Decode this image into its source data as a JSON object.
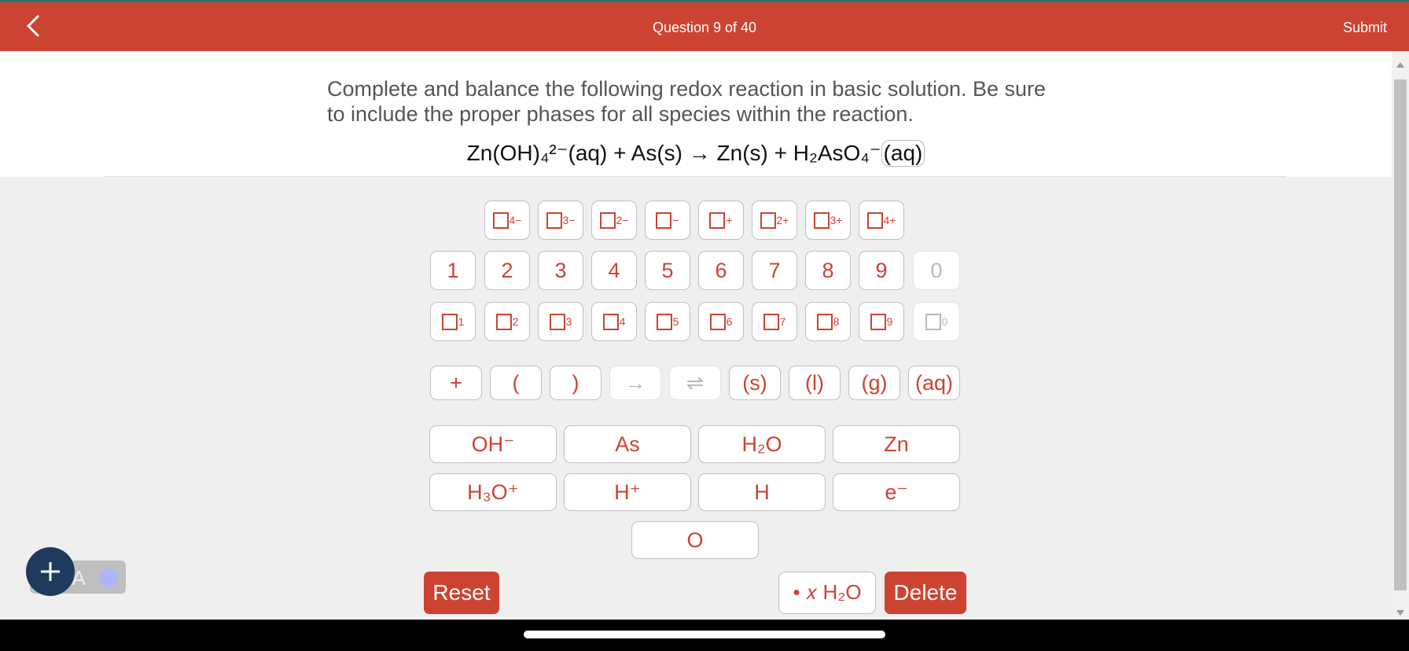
{
  "header": {
    "title": "Question 9 of 40",
    "submit_label": "Submit",
    "back_icon": "chevron-left-icon"
  },
  "question": {
    "text": "Complete and balance the following redox reaction in basic solution. Be sure to include the proper phases for all species within the reaction.",
    "reaction": {
      "lhs": "Zn(OH)₄²⁻(aq) + As(s) → Zn(s) + H₂AsO₄⁻",
      "answer_box": "(aq)"
    }
  },
  "keypad": {
    "charges": [
      {
        "sup": "4−"
      },
      {
        "sup": "3−"
      },
      {
        "sup": "2−"
      },
      {
        "sup": "−"
      },
      {
        "sup": "+"
      },
      {
        "sup": "2+"
      },
      {
        "sup": "3+"
      },
      {
        "sup": "4+"
      }
    ],
    "digits": [
      "1",
      "2",
      "3",
      "4",
      "5",
      "6",
      "7",
      "8",
      "9",
      "0"
    ],
    "subscripts": [
      "1",
      "2",
      "3",
      "4",
      "5",
      "6",
      "7",
      "8",
      "9",
      "0"
    ],
    "symbols": [
      "+",
      "(",
      ")",
      "→",
      "⇌",
      "(s)",
      "(l)",
      "(g)",
      "(aq)"
    ],
    "species_row1": [
      "OH⁻",
      "As",
      "H₂O",
      "Zn"
    ],
    "species_row2": [
      "H₃O⁺",
      "H⁺",
      "H",
      "e⁻"
    ],
    "species_row3": [
      "O"
    ]
  },
  "buttons": {
    "reset": "Reset",
    "water": "• 𝑥 H₂O",
    "delete": "Delete"
  },
  "overlay": {
    "hud_text": "Alt+A"
  },
  "colors": {
    "accent": "#cc4431",
    "fab": "#1f3a5d"
  }
}
